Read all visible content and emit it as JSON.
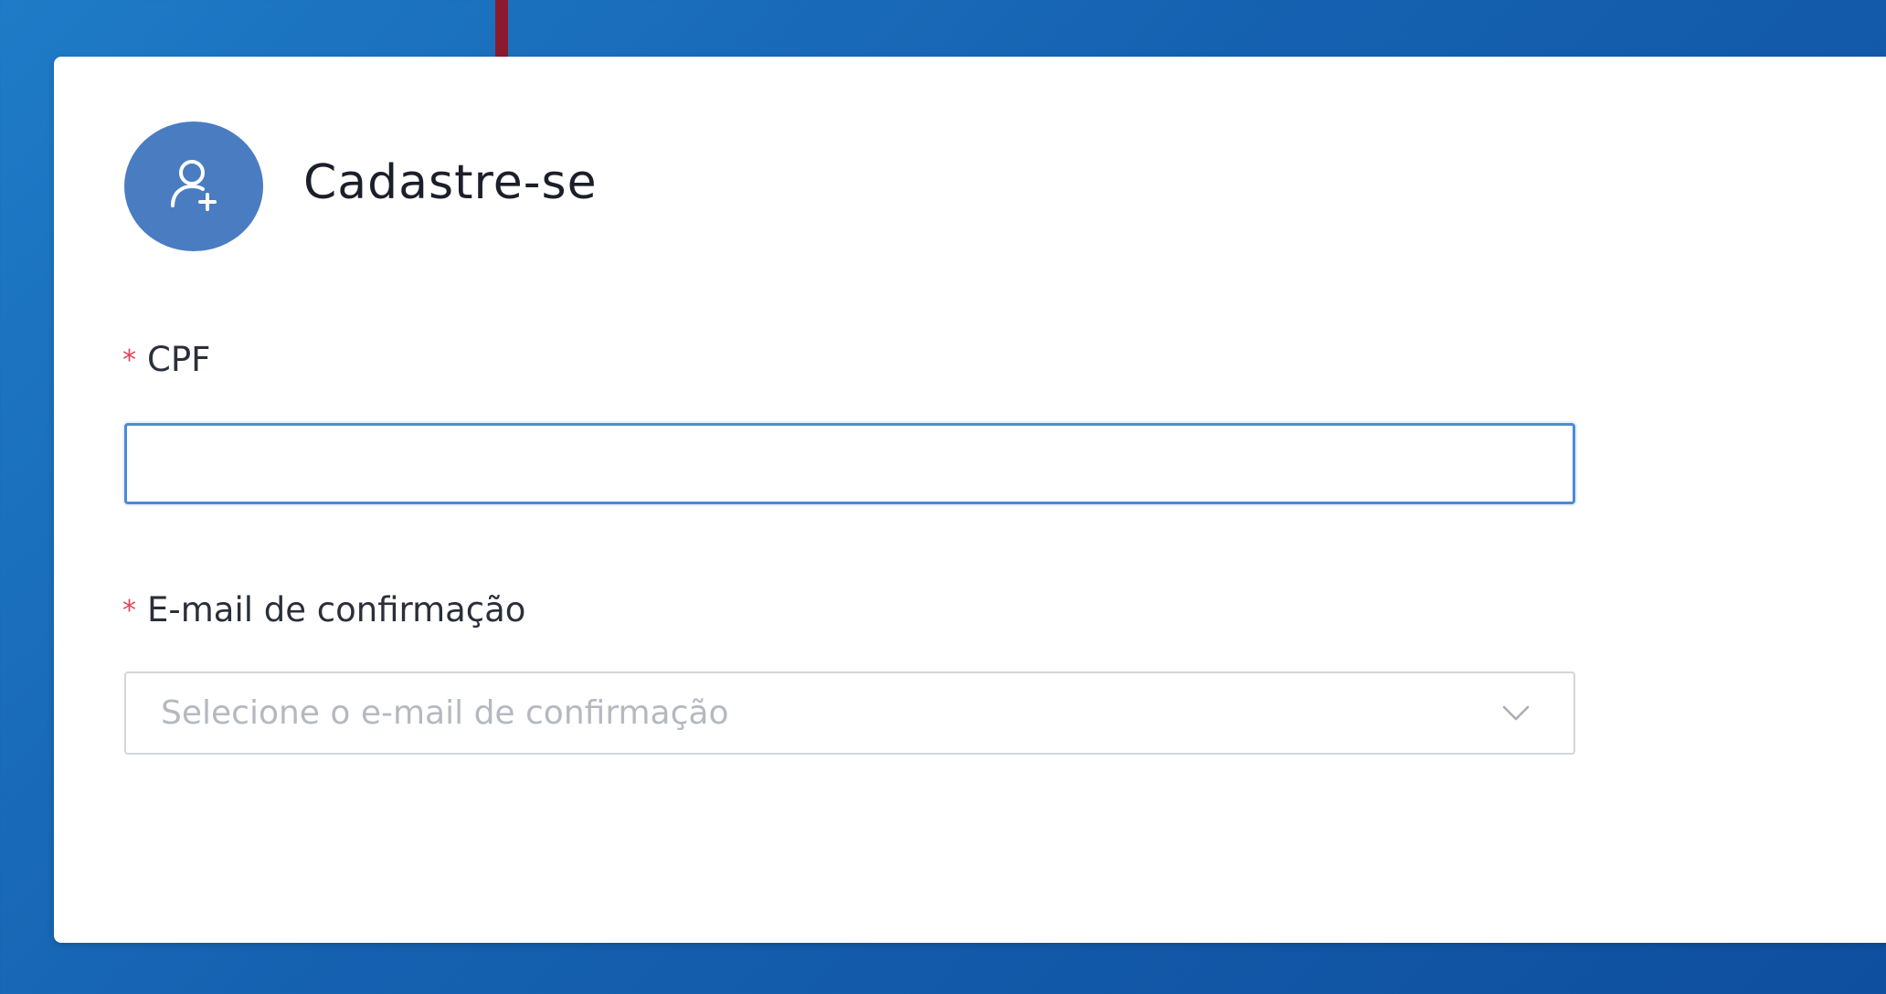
{
  "header": {
    "title": "Cadastre-se",
    "avatar_icon": "user-add-icon"
  },
  "form": {
    "cpf": {
      "required_mark": "*",
      "label": "CPF",
      "value": "",
      "placeholder": ""
    },
    "email": {
      "required_mark": "*",
      "label": "E-mail de confirmação",
      "placeholder": "Selecione o e-mail de confirmação",
      "icon": "chevron-down-icon"
    }
  },
  "colors": {
    "background": "#1561b0",
    "avatar": "#4a7cc1",
    "arrow": "#8b1a2f",
    "required": "#e0455a",
    "focus_border": "#4c8bd6"
  }
}
